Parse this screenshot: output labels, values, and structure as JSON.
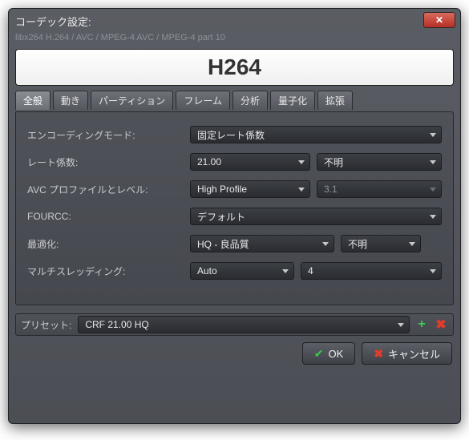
{
  "window": {
    "title": "コーデック設定:",
    "subtitle": "libx264 H.264 / AVC / MPEG-4 AVC / MPEG-4 part 10"
  },
  "banner": "H264",
  "tabs": {
    "items": [
      "全般",
      "動き",
      "パーティション",
      "フレーム",
      "分析",
      "量子化",
      "拡張"
    ],
    "active": 0
  },
  "general": {
    "encoding_mode_label": "エンコーディングモード:",
    "encoding_mode_value": "固定レート係数",
    "rate_factor_label": "レート係数:",
    "rate_factor_value": "21.00",
    "rate_factor_tune": "不明",
    "profile_label": "AVC プロファイルとレベル:",
    "profile_value": "High Profile",
    "level_value": "3.1",
    "fourcc_label": "FOURCC:",
    "fourcc_value": "デフォルト",
    "tuning_label": "最適化:",
    "tuning_value": "HQ - 良品質",
    "tuning_extra": "不明",
    "threading_label": "マルチスレッディング:",
    "threading_mode": "Auto",
    "threading_count": "4"
  },
  "preset": {
    "label": "プリセット:",
    "value": "CRF 21.00 HQ"
  },
  "buttons": {
    "ok": "OK",
    "cancel": "キャンセル"
  }
}
